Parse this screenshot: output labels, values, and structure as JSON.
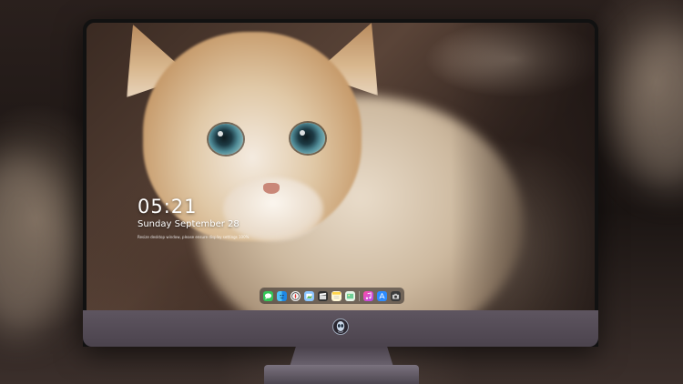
{
  "lock_screen": {
    "time": "05:21",
    "date": "Sunday September  28",
    "notice": "Resize desktop window, please ensure display settings 100%"
  },
  "dock": {
    "icons": [
      {
        "name": "messages-icon",
        "color": "#34c759"
      },
      {
        "name": "finder-icon",
        "color": "#1e88e5"
      },
      {
        "name": "safari-icon",
        "color": "#f2f2f2"
      },
      {
        "name": "preview-icon",
        "color": "#8cc6ff"
      },
      {
        "name": "claquette-icon",
        "color": "#2f2f2f"
      },
      {
        "name": "notes-icon",
        "color": "#ffd54a"
      },
      {
        "name": "photos-icon",
        "color": "#6fcf97"
      },
      {
        "name": "music-icon",
        "color": "#ff4fa6"
      },
      {
        "name": "app-store-icon",
        "color": "#2d8cff"
      },
      {
        "name": "screenshot-icon",
        "color": "#3a3a3a"
      }
    ]
  },
  "colors": {
    "wallpaper_accent": "#e0c8a6",
    "cat_eye": "#4f8a96",
    "chin": "#5e5560"
  }
}
